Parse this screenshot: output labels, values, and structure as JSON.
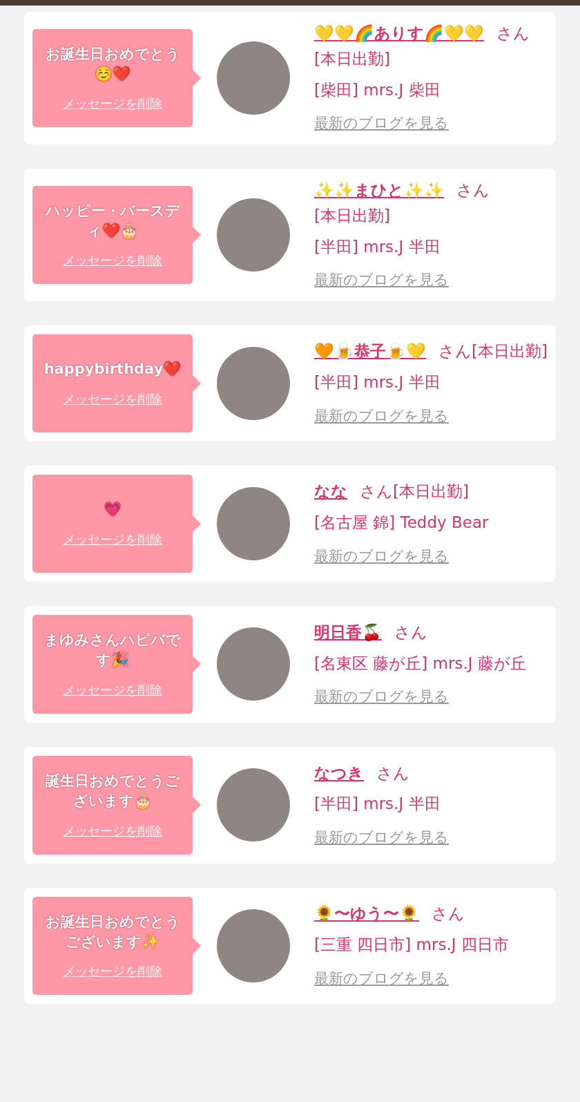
{
  "cards": [
    {
      "message": "お誕生日おめでとう☺️❤️",
      "delete_link": "メッセージを削除",
      "name": "💛💛🌈ありす🌈💛💛",
      "honorific": "さん",
      "status": "[本日出勤]",
      "shop": "[柴田] mrs.J 柴田",
      "blog_link": "最新のブログを見る"
    },
    {
      "message": "ハッピー・バースディ❤️🎂",
      "delete_link": "メッセージを削除",
      "name": "✨✨まひと✨✨",
      "honorific": "さん",
      "status": "[本日出勤]",
      "shop": "[半田] mrs.J 半田",
      "blog_link": "最新のブログを見る"
    },
    {
      "message": "happybirthday❤️",
      "delete_link": "メッセージを削除",
      "name": "🧡🍺恭子🍺💛",
      "honorific": "さん",
      "status": "[本日出勤]",
      "shop": "[半田] mrs.J 半田",
      "blog_link": "最新のブログを見る"
    },
    {
      "message": "💗",
      "delete_link": "メッセージを削除",
      "name": "なな",
      "honorific": "さん",
      "status": "[本日出勤]",
      "shop": "[名古屋 錦] Teddy Bear",
      "blog_link": "最新のブログを見る"
    },
    {
      "message": "まゆみさんハピバです🎉",
      "delete_link": "メッセージを削除",
      "name": "明日香🍒",
      "honorific": "さん",
      "shop": "[名東区 藤が丘] mrs.J 藤が丘",
      "blog_link": "最新のブログを見る"
    },
    {
      "message": "誕生日おめでとうございます🎂",
      "delete_link": "メッセージを削除",
      "name": "なつき",
      "honorific": "さん",
      "shop": "[半田] mrs.J 半田",
      "blog_link": "最新のブログを見る"
    },
    {
      "message": "お誕生日おめでとうございます✨",
      "delete_link": "メッセージを削除",
      "name": "🌻〜ゆう〜🌻",
      "honorific": "さん",
      "shop": "[三重 四日市] mrs.J 四日市",
      "blog_link": "最新のブログを見る"
    }
  ]
}
